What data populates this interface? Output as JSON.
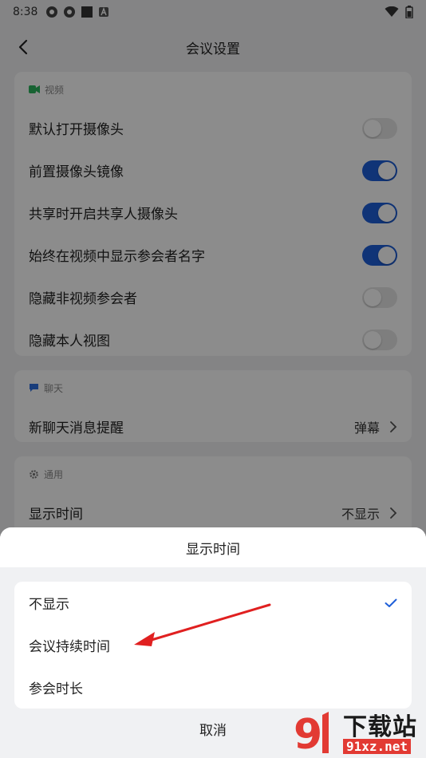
{
  "status_bar": {
    "time": "8:38"
  },
  "nav": {
    "title": "会议设置"
  },
  "video_section": {
    "header": "视频",
    "items": [
      {
        "label": "默认打开摄像头",
        "on": false
      },
      {
        "label": "前置摄像头镜像",
        "on": true
      },
      {
        "label": "共享时开启共享人摄像头",
        "on": true
      },
      {
        "label": "始终在视频中显示参会者名字",
        "on": true
      },
      {
        "label": "隐藏非视频参会者",
        "on": false
      },
      {
        "label": "隐藏本人视图",
        "on": false
      }
    ]
  },
  "chat_section": {
    "header": "聊天",
    "item": {
      "label": "新聊天消息提醒",
      "value": "弹幕"
    }
  },
  "general_section": {
    "header": "通用",
    "item": {
      "label": "显示时间",
      "value": "不显示"
    }
  },
  "sheet": {
    "title": "显示时间",
    "options": [
      {
        "label": "不显示",
        "selected": true
      },
      {
        "label": "会议持续时间",
        "selected": false
      },
      {
        "label": "参会时长",
        "selected": false
      }
    ],
    "cancel": "取消"
  },
  "colors": {
    "accent": "#1e5fd9",
    "arrow": "#e02020",
    "video_icon": "#2db55d",
    "chat_icon": "#2f6fe0"
  },
  "watermark": {
    "title": "下载站",
    "url": "91xz.net"
  }
}
